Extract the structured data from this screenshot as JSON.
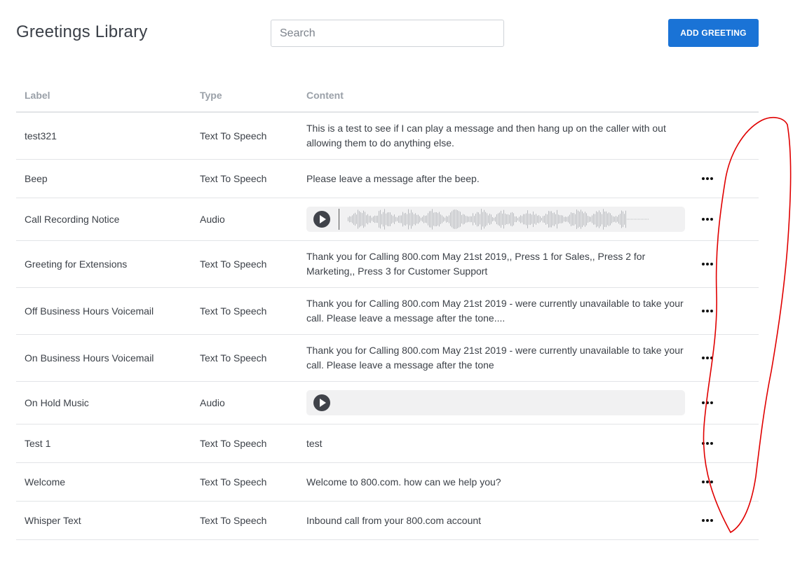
{
  "page": {
    "title": "Greetings Library",
    "search_placeholder": "Search",
    "add_button_label": "ADD GREETING"
  },
  "table": {
    "columns": [
      "Label",
      "Type",
      "Content"
    ],
    "rows": [
      {
        "label": "test321",
        "type": "Text To Speech",
        "content": "This is a test to see if I can play a message and then hang up on the caller with out allowing them to do anything else.",
        "has_actions": false
      },
      {
        "label": "Beep",
        "type": "Text To Speech",
        "content": "Please leave a message after the beep.",
        "has_actions": true
      },
      {
        "label": "Call Recording Notice",
        "type": "Audio",
        "content": "",
        "has_actions": true
      },
      {
        "label": "Greeting for Extensions",
        "type": "Text To Speech",
        "content": "Thank you for Calling 800.com May 21st 2019,, Press 1 for Sales,, Press 2 for Marketing,, Press 3 for Customer Support",
        "has_actions": true
      },
      {
        "label": "Off Business Hours Voicemail",
        "type": "Text To Speech",
        "content": "Thank you for Calling 800.com May 21st 2019 - were currently unavailable to take your call. Please leave a message after the tone....",
        "has_actions": true
      },
      {
        "label": "On Business Hours Voicemail",
        "type": "Text To Speech",
        "content": "Thank you for Calling 800.com May 21st 2019 - were currently unavailable to take your call. Please leave a message after the tone",
        "has_actions": true
      },
      {
        "label": "On Hold Music",
        "type": "Audio",
        "content": "",
        "has_actions": true
      },
      {
        "label": "Test 1",
        "type": "Text To Speech",
        "content": "test",
        "has_actions": true
      },
      {
        "label": "Welcome",
        "type": "Text To Speech",
        "content": "Welcome to 800.com. how can we help you?",
        "has_actions": true
      },
      {
        "label": "Whisper Text",
        "type": "Text To Speech",
        "content": "Inbound call from your 800.com account",
        "has_actions": true
      }
    ]
  },
  "colors": {
    "accent": "#1a73d6",
    "annotation": "#e00000"
  },
  "icons": {
    "actions": "more-horizontal-icon",
    "play": "play-icon"
  }
}
